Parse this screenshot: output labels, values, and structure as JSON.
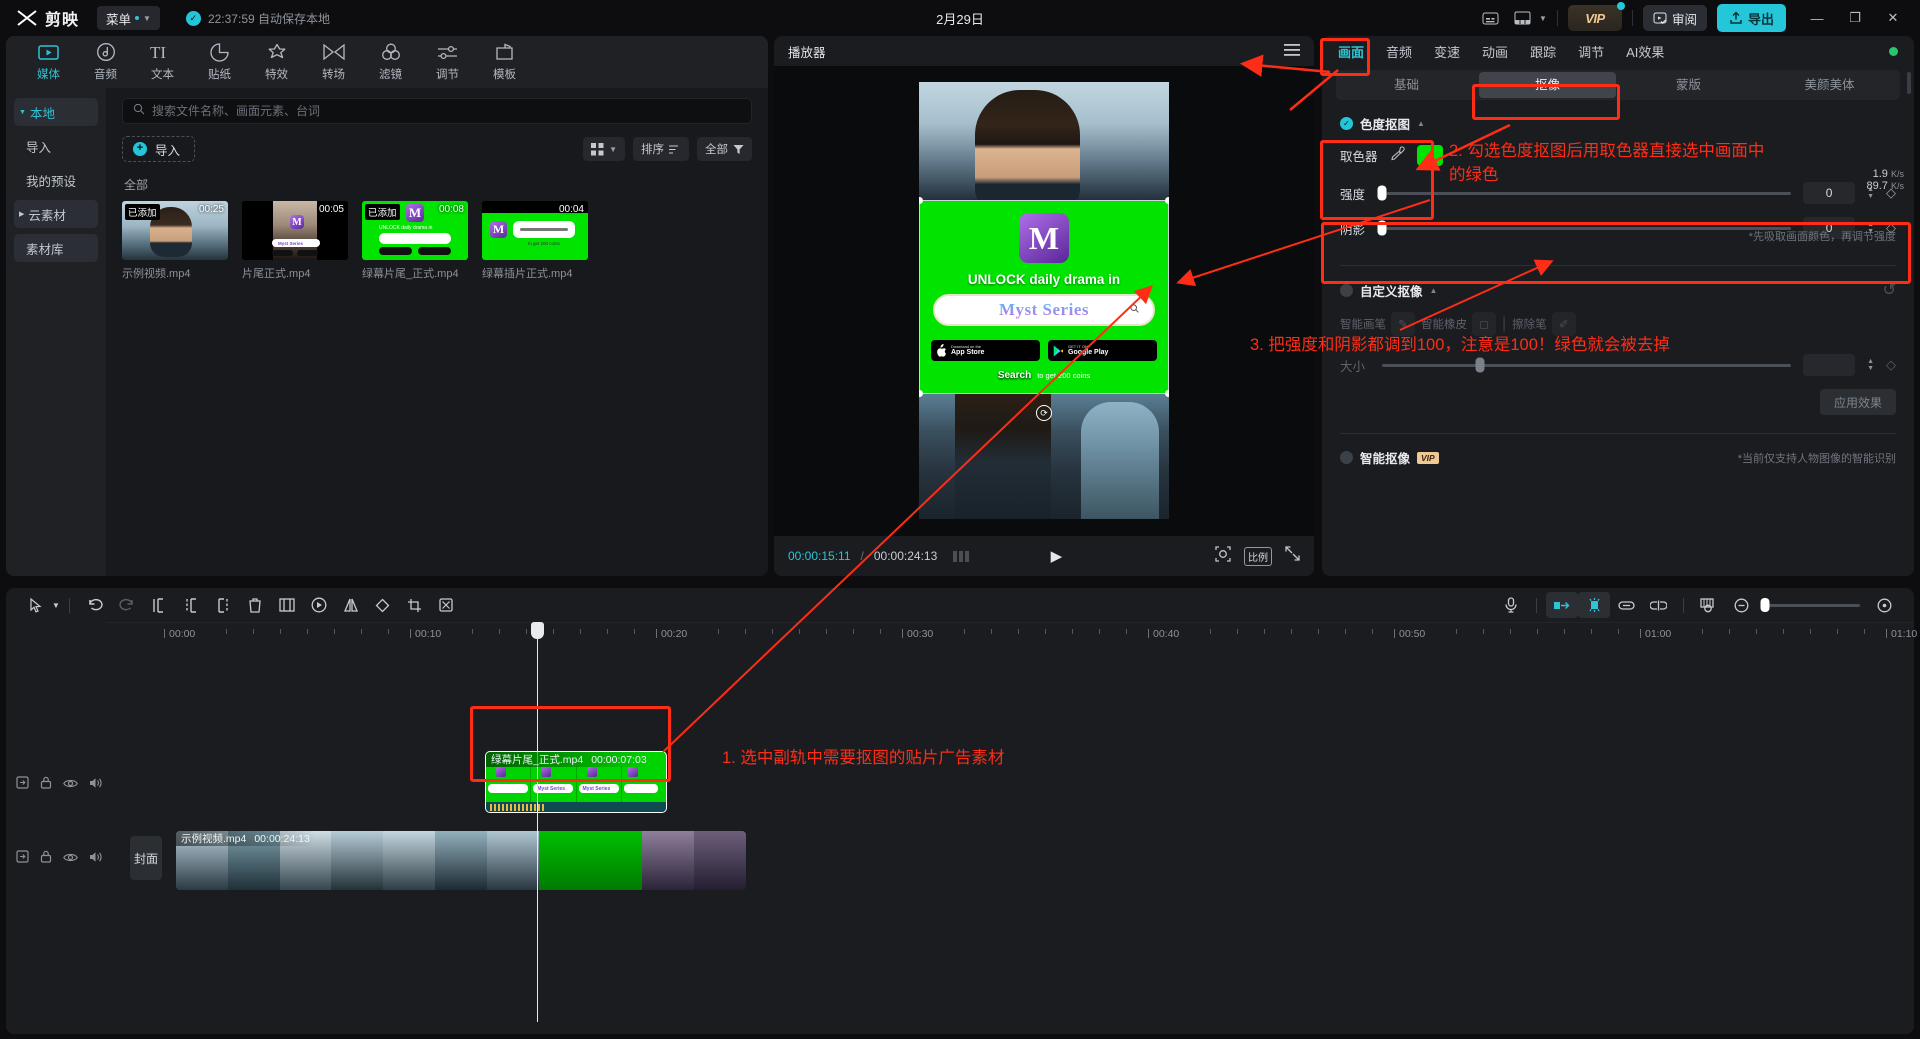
{
  "titlebar": {
    "brand": "剪映",
    "menu_label": "菜单",
    "autosave": "22:37:59 自动保存本地",
    "doc_title": "2月29日",
    "vip_label": "VIP",
    "review_label": "审阅",
    "export_label": "导出",
    "minimize": "—",
    "maximize": "❐",
    "close": "✕"
  },
  "category_tabs": [
    {
      "label": "媒体",
      "icon": "media-icon",
      "active": true
    },
    {
      "label": "音频",
      "icon": "audio-icon",
      "active": false
    },
    {
      "label": "文本",
      "icon": "text-icon",
      "active": false
    },
    {
      "label": "贴纸",
      "icon": "sticker-icon",
      "active": false
    },
    {
      "label": "特效",
      "icon": "effects-icon",
      "active": false
    },
    {
      "label": "转场",
      "icon": "transition-icon",
      "active": false
    },
    {
      "label": "滤镜",
      "icon": "filter-icon",
      "active": false
    },
    {
      "label": "调节",
      "icon": "adjust-icon",
      "active": false
    },
    {
      "label": "模板",
      "icon": "template-icon",
      "active": false
    }
  ],
  "media_nav": [
    {
      "label": "本地",
      "active": true,
      "expandable": true
    },
    {
      "label": "导入",
      "active": false,
      "expandable": false
    },
    {
      "label": "我的预设",
      "active": false,
      "expandable": false
    },
    {
      "label": "云素材",
      "active": false,
      "expandable": true
    },
    {
      "label": "素材库",
      "active": false,
      "expandable": false
    }
  ],
  "media_panel": {
    "search_placeholder": "搜索文件名称、画面元素、台词",
    "import_label": "导入",
    "sort_label": "排序",
    "filter_label": "全部",
    "section_label": "全部",
    "items": [
      {
        "name": "示例视频.mp4",
        "duration": "00:25",
        "added": "已添加",
        "is_added": true,
        "art": "person"
      },
      {
        "name": "片尾正式.mp4",
        "duration": "00:05",
        "added": "",
        "is_added": false,
        "art": "narrow"
      },
      {
        "name": "绿幕片尾_正式.mp4",
        "duration": "00:08",
        "added": "已添加",
        "is_added": true,
        "art": "green1"
      },
      {
        "name": "绿幕插片正式.mp4",
        "duration": "00:04",
        "added": "",
        "is_added": false,
        "art": "green2"
      }
    ]
  },
  "player": {
    "title": "播放器",
    "current_time": "00:00:15:11",
    "total_time": "00:00:24:13",
    "separator": "/",
    "ratio_label": "比例",
    "ad": {
      "logo": "M",
      "headline": "UNLOCK daily drama in",
      "brand": "Myst Series",
      "store1_top": "Download on the",
      "store1_main": "App Store",
      "store2_top": "GET IT ON",
      "store2_main": "Google Play",
      "search_word": "Search",
      "coins_text": "to get 200 coins"
    }
  },
  "props": {
    "tabs": [
      {
        "label": "画面",
        "active": true
      },
      {
        "label": "音频",
        "active": false
      },
      {
        "label": "变速",
        "active": false
      },
      {
        "label": "动画",
        "active": false
      },
      {
        "label": "跟踪",
        "active": false
      },
      {
        "label": "调节",
        "active": false
      },
      {
        "label": "AI效果",
        "active": false
      }
    ],
    "sub_tabs": [
      {
        "label": "基础",
        "active": false
      },
      {
        "label": "抠像",
        "active": true
      },
      {
        "label": "蒙版",
        "active": false
      },
      {
        "label": "美颜美体",
        "active": false
      }
    ],
    "chroma_label": "色度抠图",
    "picker_label": "取色器",
    "picker_color": "#00e400",
    "picker_hint": "*先吸取画面颜色，再调节强度",
    "intensity_label": "强度",
    "intensity_value": "0",
    "shadow_label": "阴影",
    "shadow_value": "0",
    "custom_label": "自定义抠像",
    "custom_tools": [
      {
        "label": "智能画笔"
      },
      {
        "label": "智能橡皮"
      },
      {
        "label": "擦除笔"
      }
    ],
    "size_label": "大小",
    "size_value": "",
    "apply_label": "应用效果",
    "smart_label": "智能抠像",
    "smart_vip": "VIP",
    "smart_hint": "*当前仅支持人物图像的智能识别",
    "net_down": "1.9",
    "net_down_unit": "K/s",
    "net_up": "89.7",
    "net_up_unit": "K/s"
  },
  "timeline": {
    "ruler_marks": [
      "00:00",
      "00:10",
      "00:20",
      "00:30",
      "00:40",
      "00:50",
      "01:00",
      "01:10"
    ],
    "cover_label": "封面",
    "clips": [
      {
        "name": "绿幕片尾_正式.mp4",
        "duration": "00:00:07:03",
        "track": "overlay",
        "selected": true
      },
      {
        "name": "示例视频.mp4",
        "duration": "00:00:24:13",
        "track": "main",
        "selected": false
      }
    ]
  },
  "annotations": [
    {
      "id": "step1",
      "text": "1. 选中副轨中需要抠图的贴片广告素材"
    },
    {
      "id": "step2",
      "text": "2. 勾选色度抠图后用取色器直接选中画面中\n的绿色"
    },
    {
      "id": "step3",
      "text": "3. 把强度和阴影都调到100，注意是100！绿色就会被去掉"
    }
  ]
}
